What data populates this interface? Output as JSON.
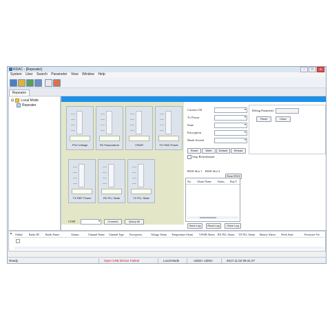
{
  "window": {
    "title": "RDAC - [Repeater]",
    "controls": [
      "-",
      "□",
      "x"
    ]
  },
  "menu": [
    "System",
    "User",
    "Search",
    "Parameter",
    "View",
    "Window",
    "Help"
  ],
  "toolbar": {
    "buttons": [
      "login-icon",
      "logout-icon",
      "connect-icon",
      "monitor-icon",
      "report-icon",
      "exit-icon"
    ]
  },
  "tabs": [
    {
      "label": "Repeater"
    }
  ],
  "tree": {
    "root": "Local Mode",
    "child": "Repeater"
  },
  "gauges": [
    {
      "label": "PSU Voltage"
    },
    {
      "label": "PA Temperature"
    },
    {
      "label": "VSWR"
    },
    {
      "label": "TX FWD Power"
    },
    {
      "label": "TX REF Power"
    },
    {
      "label": "RX PLL State"
    },
    {
      "label": "TX PLL State"
    }
  ],
  "connect": {
    "label": "COM",
    "connect_btn": "Connect",
    "query_btn": "Query All"
  },
  "settings": {
    "fields": [
      "Current CH",
      "Tx Power",
      "State",
      "Encryption",
      "Mode Switch"
    ],
    "buttons": [
      "Reset",
      "Write",
      "Default",
      "Reload"
    ],
    "checkbox": "Stop Refreshment"
  },
  "debug": {
    "label": "Debug Parameter",
    "read": "Read",
    "clear": "Clear"
  },
  "rssi": {
    "tabs": [
      "RSSI Slot 1",
      "RSSI Slot 2"
    ],
    "read_btn": "Read RSSI",
    "columns": [
      "No.",
      "Alarm Name",
      "Status",
      "Run T"
    ],
    "buttons": [
      "Save Log",
      "Read Log",
      "Clear Log"
    ]
  },
  "alarm_table": {
    "columns": [
      "Online",
      "Radio ID",
      "Radio Name",
      "Alarms",
      "Channel Name",
      "Channel Type",
      "Encryption",
      "Voltage Alarm",
      "Temperature Alarm",
      "VSWR Alarm",
      "RX PLL Alarm",
      "TX PLL Alarm",
      "Battery Alarm",
      "Work State",
      "Firmware Ver"
    ]
  },
  "status": {
    "ready": "Ready",
    "device": "Open USB Device Failed!",
    "mode": "Local Mode",
    "user": "Admin: Admin",
    "time": "2017.11.03 08:41:27",
    "device_color": "#d02020"
  }
}
